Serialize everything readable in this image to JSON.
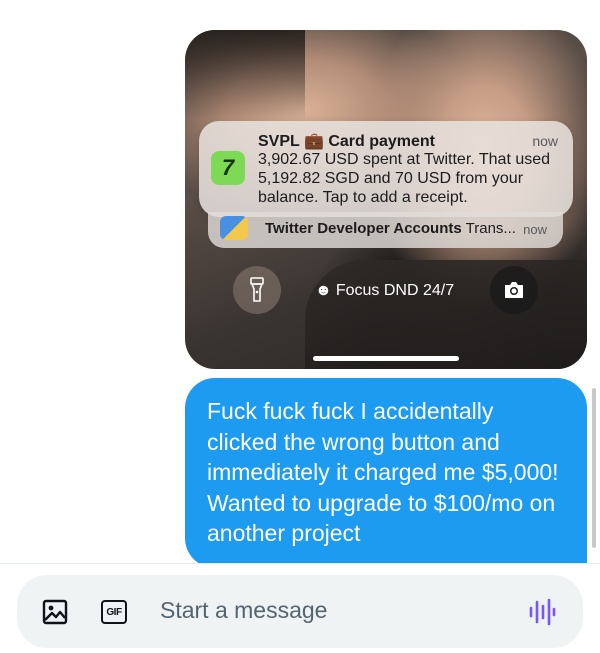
{
  "lock_screen": {
    "notification": {
      "title": "SVPL 💼 Card payment",
      "time": "now",
      "body": "3,902.67 USD spent at Twitter. That used 5,192.82 SGD and 70 USD from your balance. Tap to add a receipt.",
      "app_icon_glyph": "7"
    },
    "notification2": {
      "app": "Twitter Developer Accounts",
      "preview": "Trans...",
      "time": "now"
    },
    "focus_label": "Focus DND 24/7",
    "focus_glyph": "☻"
  },
  "message": {
    "text": "Fuck fuck fuck I accidentally clicked the wrong button and immediately it charged me $5,000! Wanted to upgrade to $100/mo on another project",
    "bubble_color": "#1d9bf0"
  },
  "composer": {
    "placeholder": "Start a message",
    "gif_label": "GIF",
    "voice_color": "#7856ff"
  },
  "icons": [
    "image-icon",
    "gif-icon",
    "voice-icon",
    "flashlight-icon",
    "camera-icon"
  ]
}
